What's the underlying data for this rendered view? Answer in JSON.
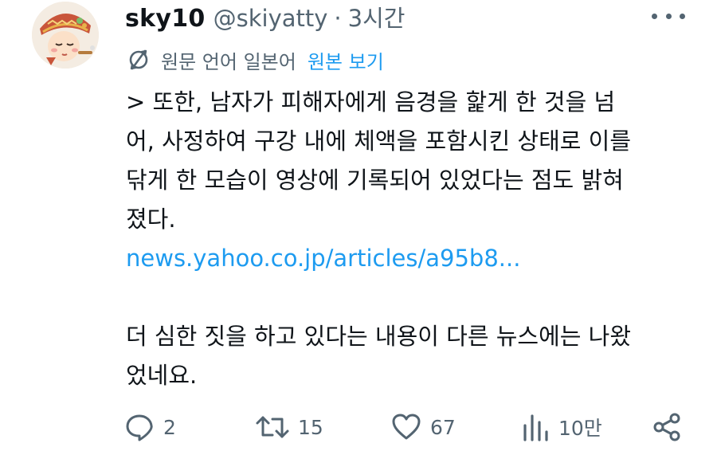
{
  "tweet": {
    "display_name": "sky10",
    "handle": "@skiyatty",
    "separator": "·",
    "time": "3시간",
    "translate_label": "원문 언어 일본어",
    "translate_link": "원본 보기",
    "body_lines": [
      "> 또한, 남자가 피해자에게 음경을 핥게 한 것을 넘",
      "어, 사정하여 구강 내에 체액을 포함시킨 상태로 이를",
      "닦게 한 모습이 영상에 기록되어 있었다는 점도 밝혀",
      "졌다."
    ],
    "link_text": "news.yahoo.co.jp/articles/a95b8...",
    "body_lines_2": [
      "더 심한 짓을 하고 있다는 내용이 다른 뉴스에는 나왔",
      "었네요."
    ]
  },
  "actions": {
    "replies": "2",
    "retweets": "15",
    "likes": "67",
    "views": "10만"
  },
  "icons": {
    "more": "more-dots-icon",
    "translate": "translate-icon",
    "reply": "reply-icon",
    "retweet": "retweet-icon",
    "like": "heart-icon",
    "views": "views-chart-icon",
    "share": "share-icon"
  },
  "colors": {
    "text": "#0f1419",
    "secondary": "#536471",
    "link": "#1d9bf0"
  }
}
